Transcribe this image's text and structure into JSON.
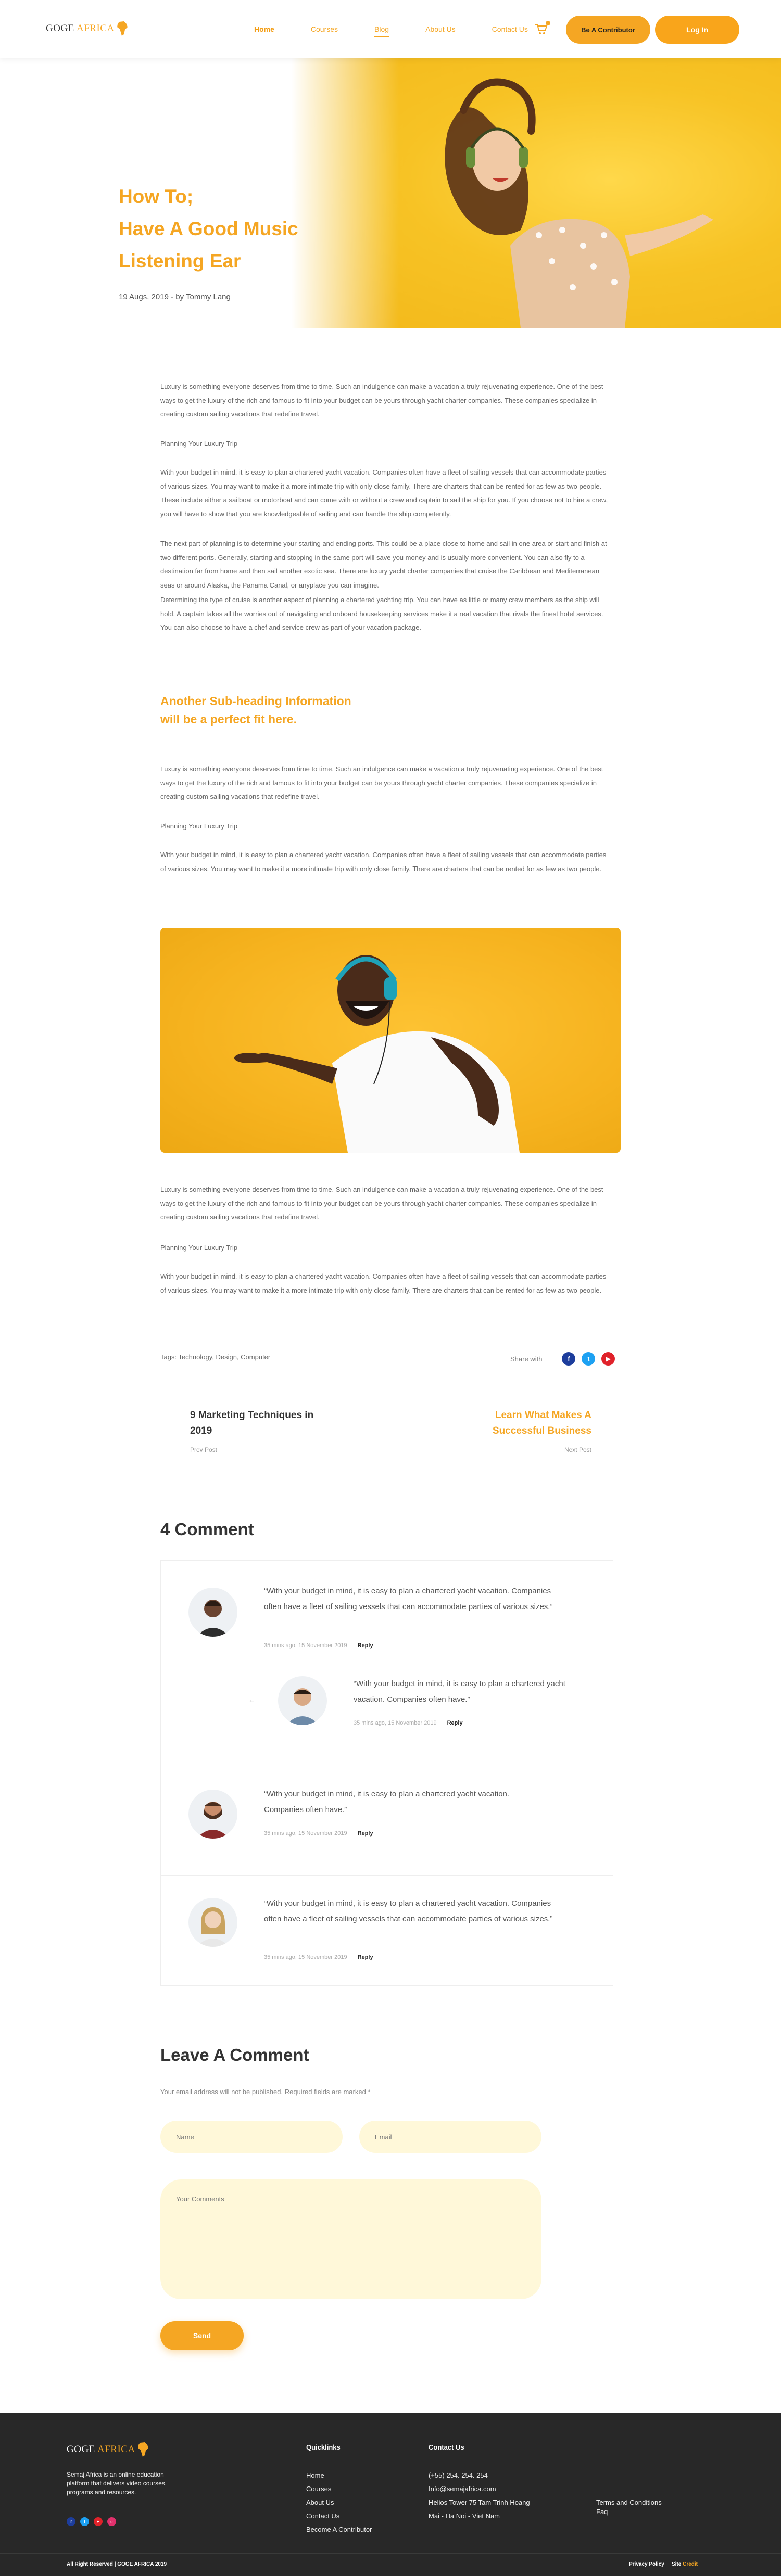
{
  "brand": {
    "logo_text_dark": "GOGE",
    "logo_text_accent": "AFRICA",
    "accent": "#f5a623"
  },
  "nav": {
    "items": [
      "Home",
      "Courses",
      "Blog",
      "About Us",
      "Contact Us"
    ],
    "cart_icon": "cart-icon",
    "contributor_label": "Be A Contributor",
    "login_label": "Log In"
  },
  "hero": {
    "title_line1": "How To;",
    "title_line2": "Have A Good Music",
    "title_line3": "Listening Ear",
    "meta": "19 Augs, 2019 - by Tommy Lang"
  },
  "article": {
    "p1": "Luxury is something everyone deserves from time to time. Such an indulgence can make a vacation a truly rejuvenating experience. One of the best ways to get the luxury of the rich and famous to fit into your budget can be yours through yacht charter companies. These companies specialize in creating custom sailing vacations that redefine travel.",
    "p2": "Planning Your Luxury Trip",
    "p3": "With your budget in mind, it is easy to plan a chartered yacht vacation. Companies often have a fleet of sailing vessels that can accommodate parties of various sizes. You may want to make it a more intimate trip with only close family. There are charters that can be rented for as few as two people. These include either a sailboat or motorboat and can come with or without a crew and captain to sail the ship for you. If you choose not to hire a crew, you will have to show that you are knowledgeable of sailing and can handle the ship competently.",
    "p4": "The next part of planning is to determine your starting and ending ports. This could be a place close to home and sail in one area or start and finish at two different ports. Generally, starting and stopping in the same port will save you money and is usually more convenient. You can also fly to a destination far from home and then sail another exotic sea. There are luxury yacht charter companies that cruise the Caribbean and Mediterranean seas or around Alaska, the Panama Canal, or anyplace you can imagine.",
    "p5": "Determining the type of cruise is another aspect of planning a chartered yachting trip. You can have as little or many crew members as the ship will hold. A captain takes all the worries out of navigating and onboard housekeeping services make it a real vacation that rivals the finest hotel services. You can also choose to have a chef and service crew as part of your vacation package.",
    "subhead_line1": "Another Sub-heading Information",
    "subhead_line2": "will be a perfect fit here.",
    "p6": "Luxury is something everyone deserves from time to time. Such an indulgence can make a vacation a truly rejuvenating experience. One of the best ways to get the luxury of the rich and famous to fit into your budget can be yours through yacht charter companies. These companies specialize in creating custom sailing vacations that redefine travel.",
    "p7": "Planning Your Luxury Trip",
    "p8": "With your budget in mind, it is easy to plan a chartered yacht vacation. Companies often have a fleet of sailing vessels that can accommodate parties of various sizes. You may want to make it a more intimate trip with only close family. There are charters that can be rented for as few as two people.",
    "p9": "Luxury is something everyone deserves from time to time. Such an indulgence can make a vacation a truly rejuvenating experience. One of the best ways to get the luxury of the rich and famous to fit into your budget can be yours through yacht charter companies. These companies specialize in creating custom sailing vacations that redefine travel.",
    "p10": "Planning Your Luxury Trip",
    "p11": "With your budget in mind, it is easy to plan a chartered yacht vacation. Companies often have a fleet of sailing vessels that can accommodate parties of various sizes. You may want to make it a more intimate trip with only close family. There are charters that can be rented for as few as two people.",
    "tags": "Tags: Technology, Design, Computer",
    "share_label": "Share with",
    "share_icons": [
      "facebook-icon",
      "twitter-icon",
      "youtube-icon"
    ],
    "share_colors": {
      "facebook": "#1d3d9c",
      "twitter": "#1da1f2",
      "youtube": "#e0222a"
    }
  },
  "post_nav": {
    "prev_title": "9 Marketing Techniques in 2019",
    "prev_label": "Prev Post",
    "next_title": "Learn What Makes A Successful Business",
    "next_label": "Next Post"
  },
  "comments": {
    "title": "4 Comment",
    "items": [
      {
        "text": "“With your budget in mind, it is easy to plan a chartered yacht vacation. Companies often have a fleet of sailing vessels that can accommodate parties of various sizes.”",
        "meta": "35 mins ago, 15 November 2019",
        "reply": "Reply"
      },
      {
        "text": "“With your budget in mind, it is easy to plan a chartered yacht vacation. Companies often have.”",
        "meta": "35 mins ago, 15 November 2019",
        "reply": "Reply"
      },
      {
        "text": "“With your budget in mind, it is easy to plan a chartered yacht vacation. Companies often have.”",
        "meta": "35 mins ago, 15 November 2019",
        "reply": "Reply"
      },
      {
        "text": "“With your budget in mind, it is easy to plan a chartered yacht vacation. Companies often have a fleet of sailing vessels that can accommodate parties of various sizes.”",
        "meta": "35 mins ago, 15 November 2019",
        "reply": "Reply"
      }
    ]
  },
  "leave_comment": {
    "title": "Leave A Comment",
    "note": "Your email address will not be published. Required fields are marked *",
    "name_placeholder": "Name",
    "email_placeholder": "Email",
    "comments_placeholder": "Your Comments",
    "send_label": "Send"
  },
  "footer": {
    "about": "Semaj Africa is an online education platform that delivers video courses, programs and resources.",
    "social_icons": [
      "facebook-icon",
      "twitter-icon",
      "youtube-icon",
      "instagram-icon"
    ],
    "quicklinks_title": "Quicklinks",
    "quicklinks": [
      "Home",
      "Courses",
      "About Us",
      "Contact Us",
      "Become A Contributor"
    ],
    "contact_title": "Contact Us",
    "phone": "(+55) 254. 254. 254",
    "email": "Info@semajafrica.com",
    "address1": "Helios Tower 75 Tam Trinh Hoang",
    "address2": "Mai - Ha Noi - Viet Nam",
    "extra_links": [
      "Terms and Conditions",
      "Faq"
    ],
    "copyright": "All Right Reserved | GOGE AFRICA 2019",
    "privacy": "Privacy Policy",
    "credit_prefix": "Site",
    "credit_accent": "Credit"
  }
}
